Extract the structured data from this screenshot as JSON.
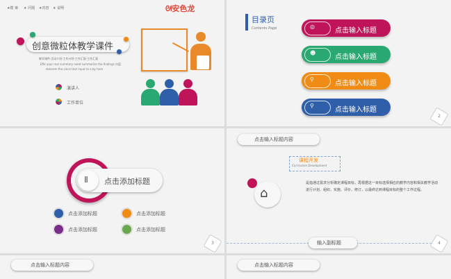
{
  "slide1": {
    "nav": [
      "★瞎 审",
      "★ 问题",
      "★内容",
      "★ 说明"
    ],
    "logo_text": "安色龙",
    "title": "创意微粒体教学课件",
    "desc1": "教学课件·活动介绍·工作计划·工作汇报·工作汇报",
    "desc2": "Effe your real summary need summarize the findings 内容",
    "desc3": "dolorem tho since text input to a by here",
    "bullet1": "演讲人",
    "bullet2": "工作单位"
  },
  "slide2": {
    "title": "目录页",
    "subtitle": "Contents Page",
    "items": [
      {
        "icon": "◎",
        "label": "点击输入标题",
        "color": "#c0145a"
      },
      {
        "icon": "☻",
        "label": "点击输入标题",
        "color": "#2aa872"
      },
      {
        "icon": "⚲",
        "label": "点击输入标题",
        "color": "#f08c16"
      },
      {
        "icon": "⚲",
        "label": "点击输入标题",
        "color": "#2f5fa8"
      }
    ],
    "number": "2"
  },
  "slide3": {
    "center_label": "点击添加标题",
    "center_glyph": "Ⅱ",
    "items": [
      "点击添加标题",
      "点击添加标题",
      "点击添加标题",
      "点击添加标题"
    ],
    "number": "3"
  },
  "slide4": {
    "header": "点击输入标题内容",
    "course_title": "课程开发",
    "course_sub": "Curriculum Development",
    "body": "是指通过需求分析确定课程目标，再根据这一目标选择相应的教学内容和相关教学活动进行计划、组织、实施、评价、修订，以最终达到课程目标的整个工作过程。",
    "sub_label": "输入副标题",
    "number": "4"
  },
  "slide5": {
    "header": "点击输入标题内容"
  },
  "slide6": {
    "header": "点击输入标题内容"
  },
  "colors": {
    "magenta": "#c0145a",
    "green": "#2aa872",
    "orange": "#f08c16",
    "blue": "#2f5fa8"
  }
}
